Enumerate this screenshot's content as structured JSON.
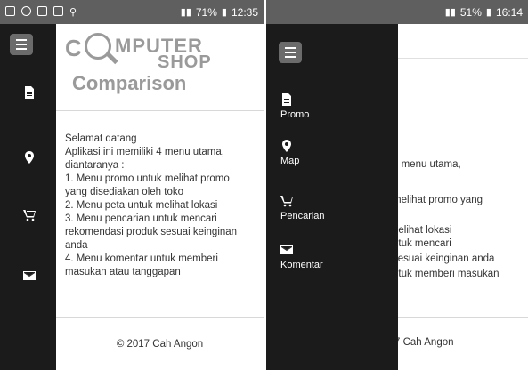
{
  "phone1": {
    "status": {
      "battery": "71%",
      "time": "12:35"
    },
    "logo": {
      "line1": "MPUTER",
      "line2": "SHOP",
      "line3": "Comparison",
      "c": "C"
    },
    "welcome": [
      "Selamat datang",
      "Aplikasi ini memiliki 4 menu utama,",
      "diantaranya :",
      "1. Menu promo untuk melihat promo",
      "yang disediakan oleh toko",
      "2. Menu peta untuk melihat lokasi",
      "3. Menu pencarian untuk mencari",
      "rekomendasi produk sesuai keinginan",
      "anda",
      "4. Menu komentar untuk memberi",
      "masukan atau tanggapan"
    ],
    "footer": "© 2017 Cah Angon"
  },
  "phone2": {
    "status": {
      "battery": "51%",
      "time": "16:14"
    },
    "menu": [
      {
        "label": "Promo",
        "icon": "document-icon"
      },
      {
        "label": "Map",
        "icon": "map-marker-icon"
      },
      {
        "label": "Pencarian",
        "icon": "cart-icon"
      },
      {
        "label": "Komentar",
        "icon": "envelope-icon"
      }
    ],
    "fragments": [
      "4 menu utama,",
      "melihat promo yang",
      "nelihat lokasi",
      "ntuk mencari",
      "sesuai keinginan anda",
      "ntuk memberi masukan"
    ],
    "footer": "7 Cah Angon"
  }
}
